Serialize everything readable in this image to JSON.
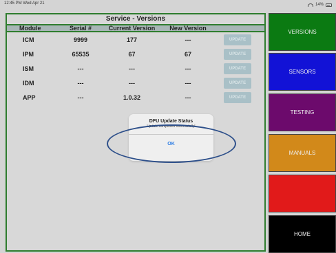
{
  "status_bar": {
    "time": "12:45 PM Wed Apr 21",
    "battery": "14%"
  },
  "panel": {
    "title": "Service - Versions"
  },
  "table": {
    "headers": {
      "module": "Module",
      "serial": "Serial #",
      "current": "Current Version",
      "new": "New Version"
    },
    "rows": [
      {
        "module": "ICM",
        "serial": "9999",
        "current": "177",
        "new": "---",
        "button": "UPDATE"
      },
      {
        "module": "IPM",
        "serial": "65535",
        "current": "67",
        "new": "67",
        "button": "UPDATE"
      },
      {
        "module": "ISM",
        "serial": "---",
        "current": "---",
        "new": "---",
        "button": "UPDATE"
      },
      {
        "module": "IDM",
        "serial": "---",
        "current": "---",
        "new": "---",
        "button": "UPDATE"
      },
      {
        "module": "APP",
        "serial": "---",
        "current": "1.0.32",
        "new": "---",
        "button": "UPDATE"
      }
    ]
  },
  "dialog": {
    "title": "DFU Update Status",
    "message": "Update completed successfully!",
    "ok": "OK"
  },
  "nav": {
    "items": [
      {
        "label": "VERSIONS",
        "color": "#0b7a12"
      },
      {
        "label": "SENSORS",
        "color": "#1212d6"
      },
      {
        "label": "TESTING",
        "color": "#6c0a6c"
      },
      {
        "label": "MANUALS",
        "color": "#d2891a"
      },
      {
        "label": "",
        "color": "#e11a1a"
      },
      {
        "label": "HOME",
        "color": "#000000"
      }
    ]
  }
}
